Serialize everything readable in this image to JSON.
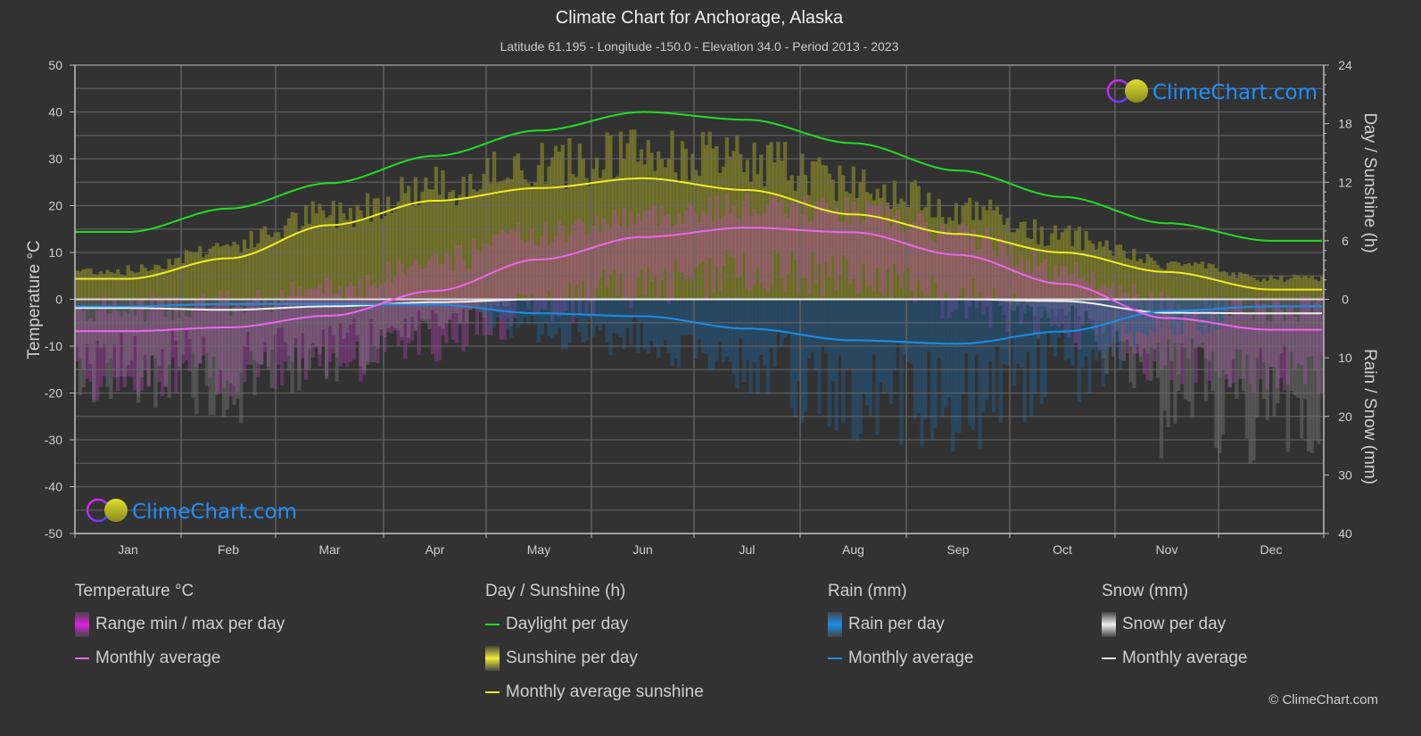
{
  "header": {
    "title": "Climate Chart for Anchorage, Alaska",
    "subtitle": "Latitude 61.195 - Longitude -150.0 - Elevation 34.0 - Period 2013 - 2023"
  },
  "watermark": {
    "text": "ClimeChart.com"
  },
  "copyright": "© ClimeChart.com",
  "colors": {
    "background": "#323232",
    "daylight": "#22dd22",
    "sunshine_avg": "#eeee22",
    "sunshine_fill": "#9c9c2a",
    "temp_avg": "#ee66ee",
    "temp_range": "#cc44cc",
    "rain": "#1a8fe8",
    "snow": "#eeeeee",
    "brand": "#1e90ff"
  },
  "legend": {
    "groups": [
      {
        "title": "Temperature °C",
        "items": [
          {
            "label": "Range min / max per day",
            "kind": "box",
            "color": "#dd22dd"
          },
          {
            "label": "Monthly average",
            "kind": "line",
            "color": "#ee66ee"
          }
        ]
      },
      {
        "title": "Day / Sunshine (h)",
        "items": [
          {
            "label": "Daylight per day",
            "kind": "line",
            "color": "#22dd22"
          },
          {
            "label": "Sunshine per day",
            "kind": "box",
            "color": "#eeee33"
          },
          {
            "label": "Monthly average sunshine",
            "kind": "line",
            "color": "#eeee22"
          }
        ]
      },
      {
        "title": "Rain (mm)",
        "items": [
          {
            "label": "Rain per day",
            "kind": "box",
            "color": "#1a8fe8"
          },
          {
            "label": "Monthly average",
            "kind": "line",
            "color": "#1a8fe8"
          }
        ]
      },
      {
        "title": "Snow (mm)",
        "items": [
          {
            "label": "Snow per day",
            "kind": "box",
            "color": "#eeeeee"
          },
          {
            "label": "Monthly average",
            "kind": "line",
            "color": "#eeeeee"
          }
        ]
      }
    ]
  },
  "chart_data": {
    "type": "line",
    "title": "Climate Chart for Anchorage, Alaska",
    "categories": [
      "Jan",
      "Feb",
      "Mar",
      "Apr",
      "May",
      "Jun",
      "Jul",
      "Aug",
      "Sep",
      "Oct",
      "Nov",
      "Dec"
    ],
    "axes": {
      "left": {
        "label": "Temperature °C",
        "range": [
          -50,
          50
        ],
        "ticks": [
          50,
          40,
          30,
          20,
          10,
          0,
          -10,
          -20,
          -30,
          -40,
          -50
        ]
      },
      "right_top": {
        "label": "Day / Sunshine (h)",
        "range": [
          0,
          24
        ],
        "ticks": [
          24,
          18,
          12,
          6,
          0
        ]
      },
      "right_bottom": {
        "label": "Rain / Snow (mm)",
        "range": [
          0,
          40
        ],
        "ticks": [
          0,
          10,
          20,
          30,
          40
        ]
      }
    },
    "grid": true,
    "series": [
      {
        "name": "Temperature monthly average",
        "axis": "left",
        "unit": "°C",
        "values": [
          -6.8,
          -6.0,
          -3.5,
          1.8,
          8.5,
          13.3,
          15.3,
          14.3,
          9.5,
          3.3,
          -4.0,
          -6.5
        ]
      },
      {
        "name": "Temperature daily max (approx)",
        "axis": "left",
        "unit": "°C",
        "values": [
          -2,
          -1,
          2,
          8,
          14,
          18,
          20,
          19,
          14,
          6,
          -1,
          -2
        ]
      },
      {
        "name": "Temperature daily min (approx)",
        "axis": "left",
        "unit": "°C",
        "values": [
          -12,
          -11,
          -9,
          -4,
          3,
          8,
          11,
          10,
          5,
          -1,
          -8,
          -11
        ]
      },
      {
        "name": "Daylight per day",
        "axis": "right_top",
        "unit": "h",
        "values": [
          6.9,
          9.3,
          11.9,
          14.7,
          17.3,
          19.2,
          18.4,
          16.0,
          13.2,
          10.5,
          7.8,
          6.0
        ]
      },
      {
        "name": "Sunshine per day (max band)",
        "axis": "right_top",
        "unit": "h",
        "values": [
          3.2,
          6.0,
          9.5,
          12.5,
          14.8,
          16.2,
          15.5,
          13.2,
          10.2,
          7.0,
          4.0,
          2.3
        ]
      },
      {
        "name": "Monthly average sunshine",
        "axis": "right_top",
        "unit": "h",
        "values": [
          2.1,
          4.2,
          7.6,
          10.1,
          11.4,
          12.4,
          11.2,
          8.7,
          6.7,
          4.8,
          2.8,
          1.0
        ]
      },
      {
        "name": "Rain monthly average",
        "axis": "right_bottom",
        "unit": "mm",
        "values": [
          1.2,
          0.8,
          0.8,
          0.9,
          2.4,
          2.9,
          5.0,
          7.0,
          7.6,
          5.5,
          2.0,
          1.2
        ]
      },
      {
        "name": "Snow monthly average",
        "axis": "right_bottom",
        "unit": "mm",
        "values": [
          1.5,
          1.8,
          1.2,
          0.5,
          0.0,
          0.0,
          0.0,
          0.0,
          0.0,
          0.3,
          2.3,
          2.4
        ]
      }
    ]
  }
}
